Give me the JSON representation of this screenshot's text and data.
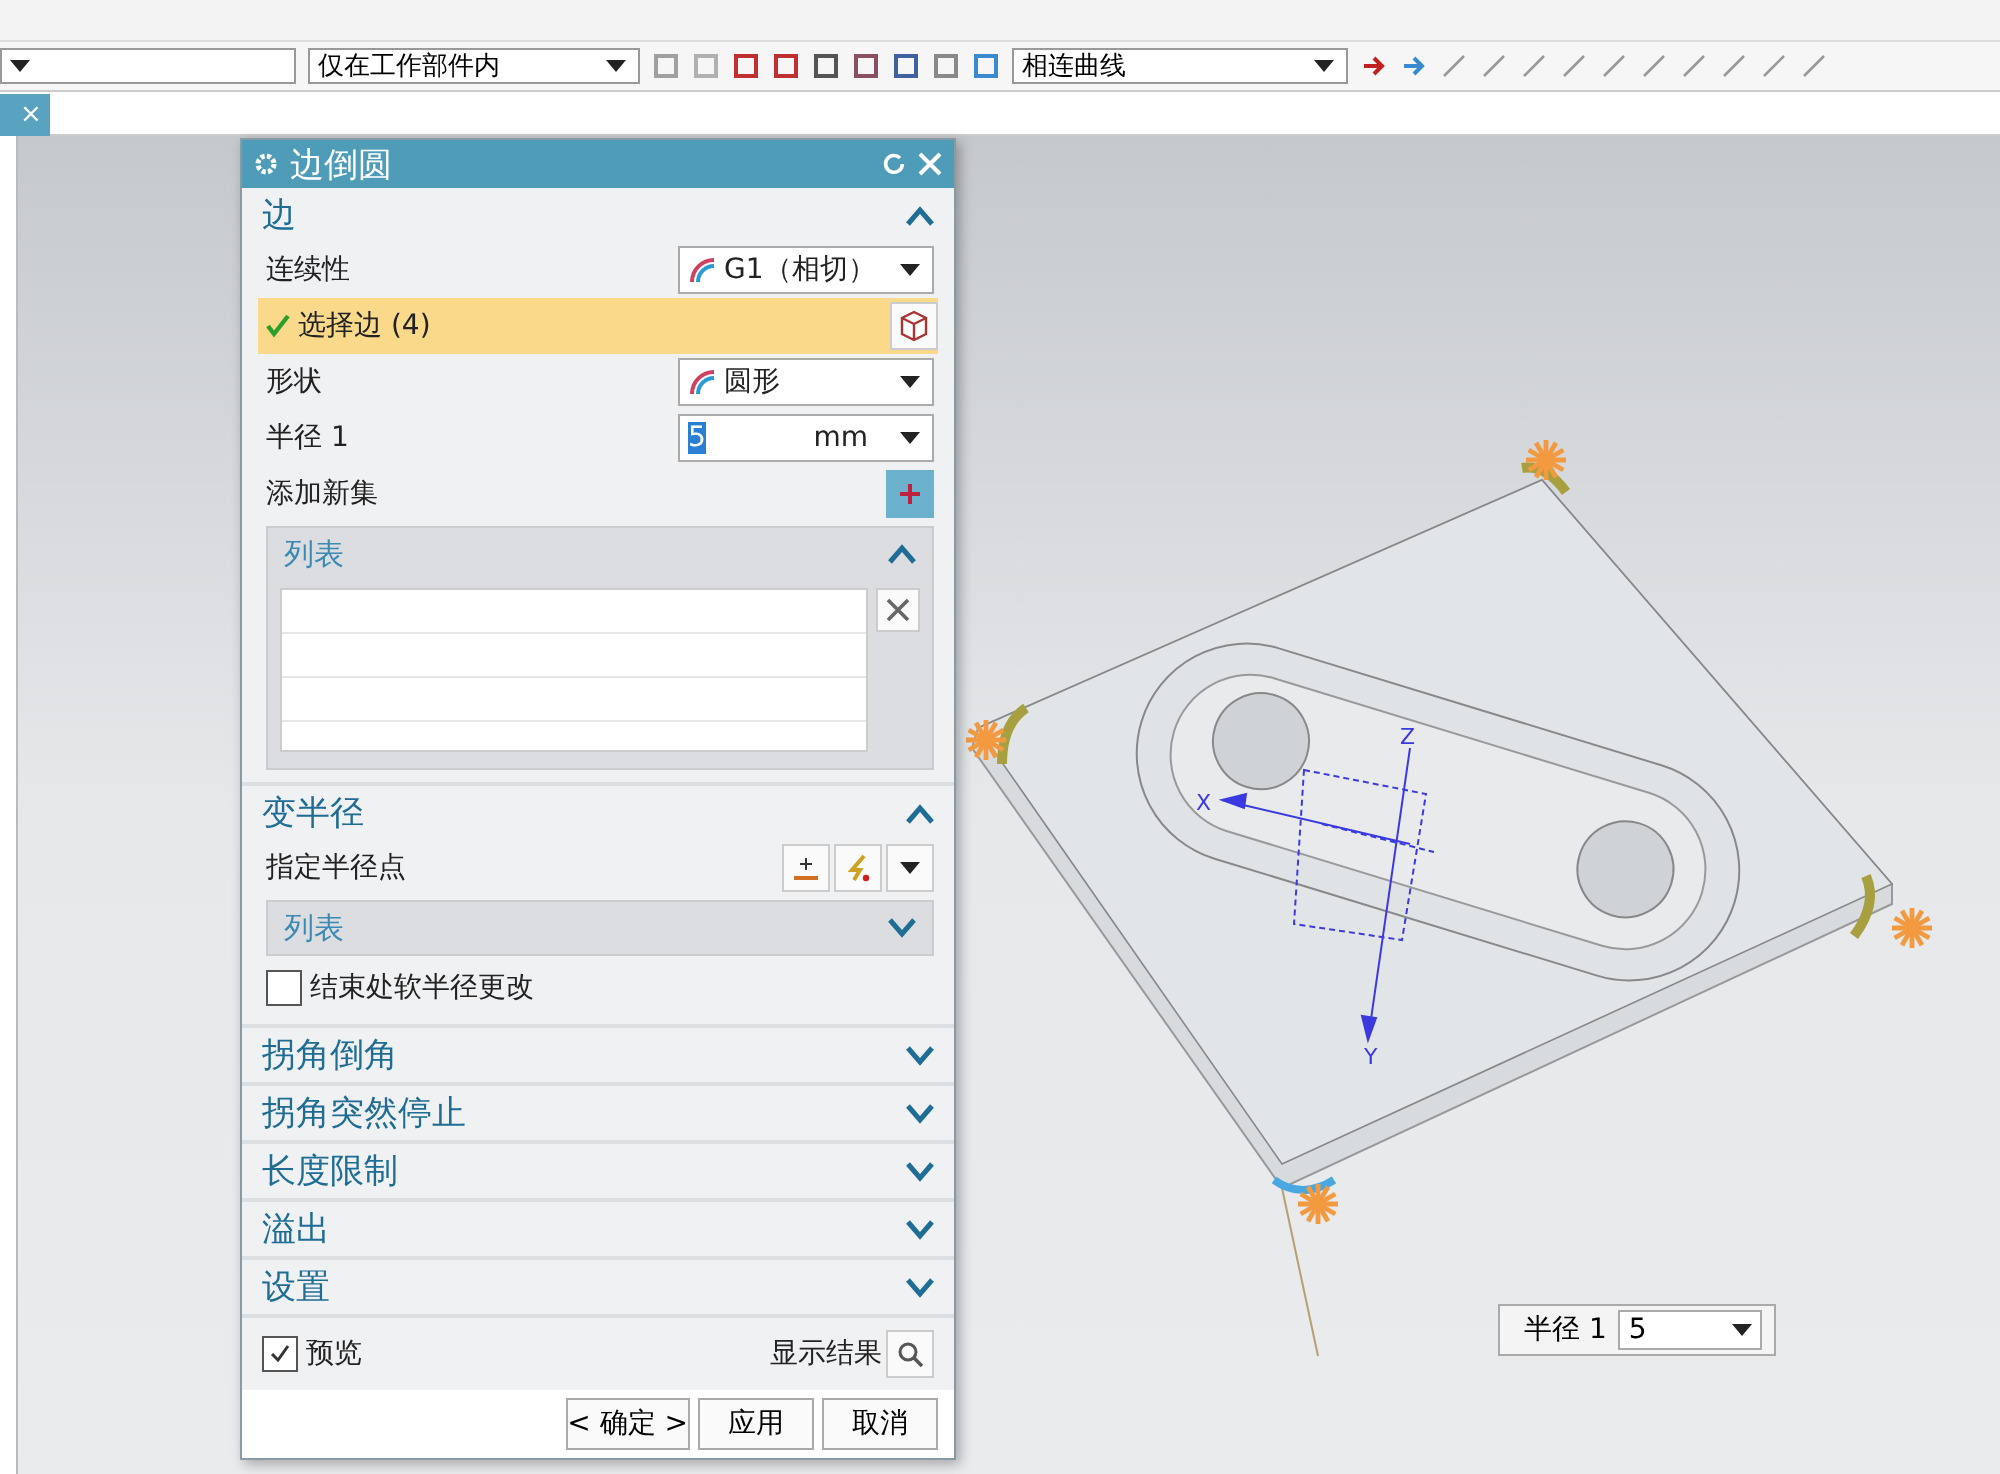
{
  "toolbar": {
    "scope_combo": "仅在工作部件内",
    "curve_rule_combo": "相连曲线"
  },
  "tab_strip": {
    "close_glyph": "×"
  },
  "dialog": {
    "title": "边倒圆",
    "sections": [
      {
        "title": "边",
        "expanded": true,
        "rows": [
          {
            "kind": "dropdown",
            "label": "连续性",
            "value": "G1（相切）"
          },
          {
            "kind": "selection",
            "label": "选择边 (4)",
            "complete": true
          },
          {
            "kind": "dropdown",
            "label": "形状",
            "value": "圆形"
          },
          {
            "kind": "value_field",
            "label": "半径 1",
            "value": "5",
            "unit": "mm"
          },
          {
            "kind": "add_set",
            "label": "添加新集"
          },
          {
            "kind": "list_group",
            "label": "列表",
            "expanded": true
          }
        ]
      },
      {
        "title": "变半径",
        "expanded": true,
        "rows": [
          {
            "kind": "point_picker",
            "label": "指定半径点"
          },
          {
            "kind": "list_group",
            "label": "列表",
            "expanded": false
          },
          {
            "kind": "checkbox",
            "label": "结束处软半径更改",
            "checked": false
          }
        ]
      },
      {
        "title": "拐角倒角",
        "expanded": false
      },
      {
        "title": "拐角突然停止",
        "expanded": false
      },
      {
        "title": "长度限制",
        "expanded": false
      },
      {
        "title": "溢出",
        "expanded": false
      },
      {
        "title": "设置",
        "expanded": false
      }
    ],
    "preview": {
      "label": "预览",
      "checked": true
    },
    "show_result": "显示结果",
    "buttons": [
      "< 确定 >",
      "应用",
      "取消"
    ]
  },
  "viewport": {
    "axis_labels": [
      "X",
      "Y",
      "Z"
    ],
    "radius_label": {
      "label": "半径 1",
      "value": "5"
    }
  }
}
